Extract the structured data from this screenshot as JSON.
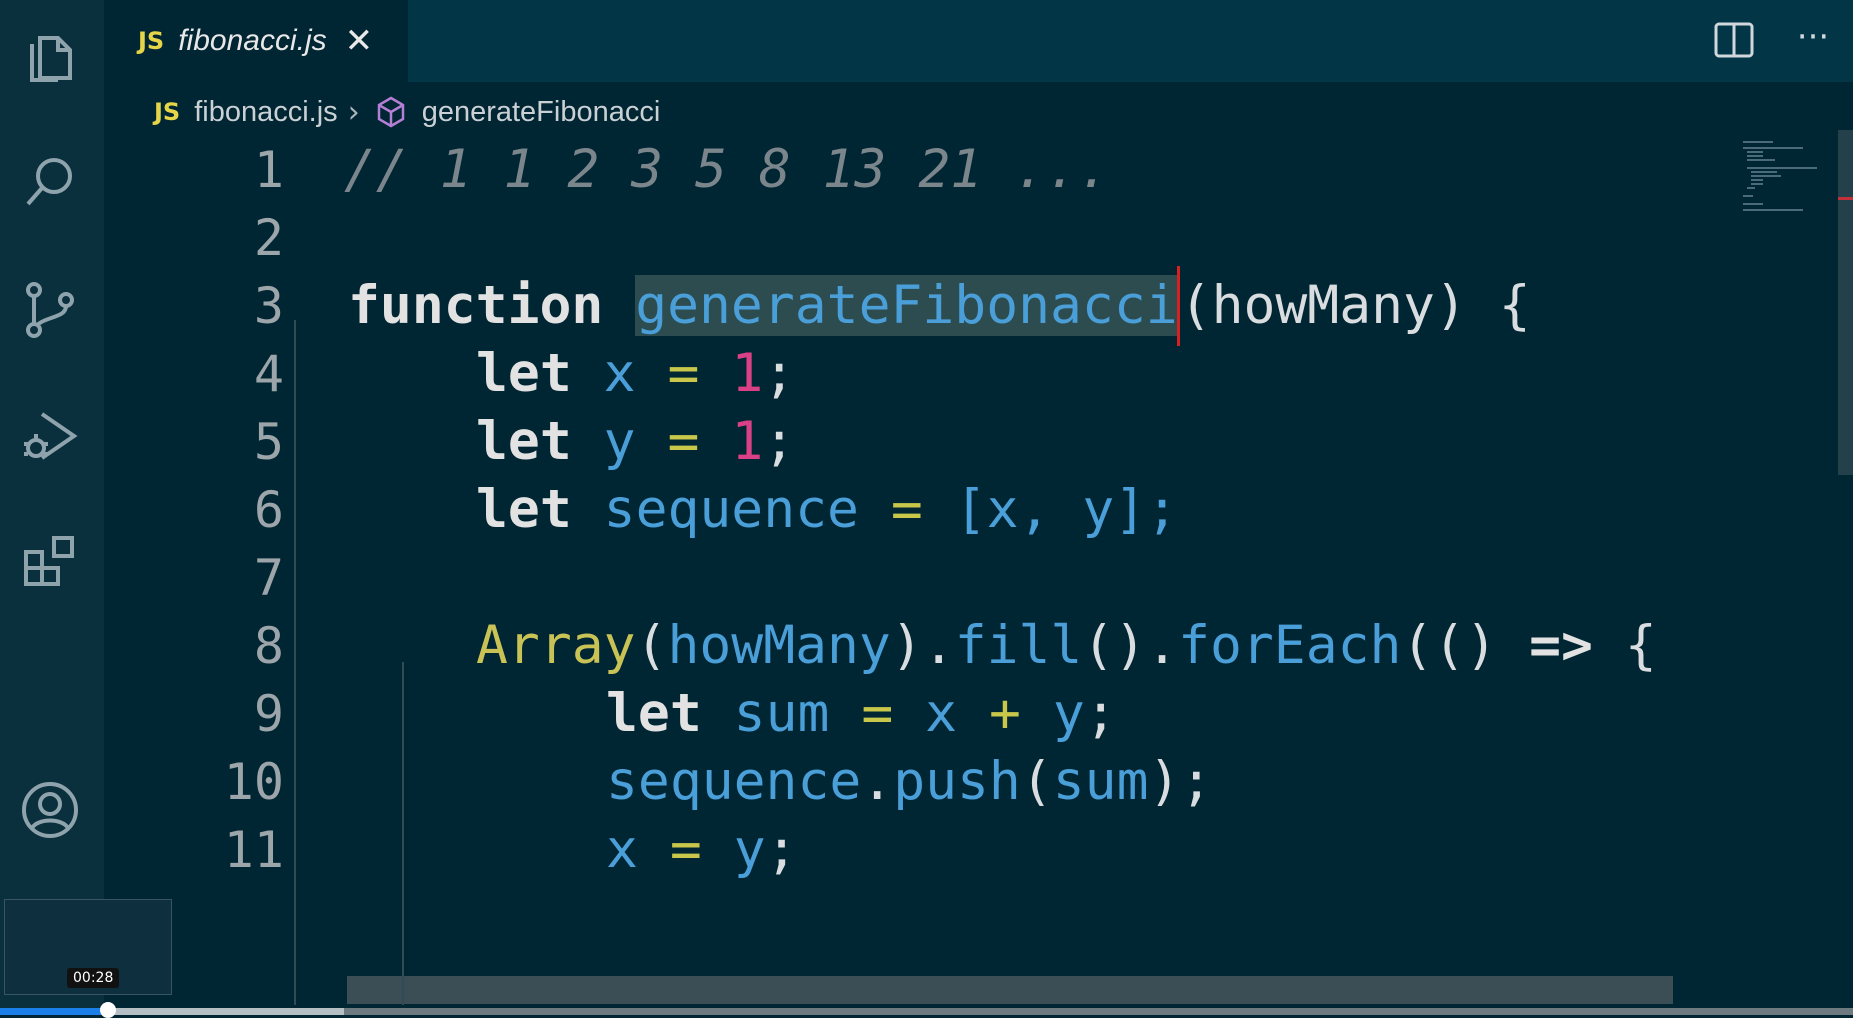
{
  "tab": {
    "js_badge": "JS",
    "label": "fibonacci.js",
    "close_glyph": "✕"
  },
  "breadcrumb": {
    "js_badge": "JS",
    "file": "fibonacci.js",
    "separator": "›",
    "symbol": "generateFibonacci"
  },
  "toolbar": {
    "more_glyph": "···"
  },
  "editor": {
    "lines": [
      {
        "n": "1"
      },
      {
        "n": "2"
      },
      {
        "n": "3"
      },
      {
        "n": "4"
      },
      {
        "n": "5"
      },
      {
        "n": "6"
      },
      {
        "n": "7"
      },
      {
        "n": "8"
      },
      {
        "n": "9"
      },
      {
        "n": "10"
      },
      {
        "n": "11"
      }
    ],
    "tokens": {
      "l1_comment": "// 1 1 2 3 5 8 13 21 ...",
      "l3_kw": "function",
      "l3_name": "generateFibonacci",
      "l3_rest": "(howMany) {",
      "let": "let",
      "x": "x",
      "y": "y",
      "eq": "=",
      "one": "1",
      "semi": ";",
      "sequence": "sequence",
      "l6_arr": "[x, y];",
      "array_cls": "Array",
      "howMany": "howMany",
      "fill": "fill",
      "forEach": "forEach",
      "arrow": "=>",
      "sum": "sum",
      "plus": "+",
      "push": "push",
      "paren_open": "(",
      "paren_close": ")",
      "dot": ".",
      "open_brace": "{",
      "empty_parens": "()"
    }
  },
  "video": {
    "timestamp": "00:28",
    "progress_fraction": 0.058
  },
  "colors": {
    "editor_bg": "#002533",
    "keyword": "#e2e2e2",
    "variable": "#4a9fd8",
    "number": "#d94085",
    "operator": "#c8c74a"
  }
}
